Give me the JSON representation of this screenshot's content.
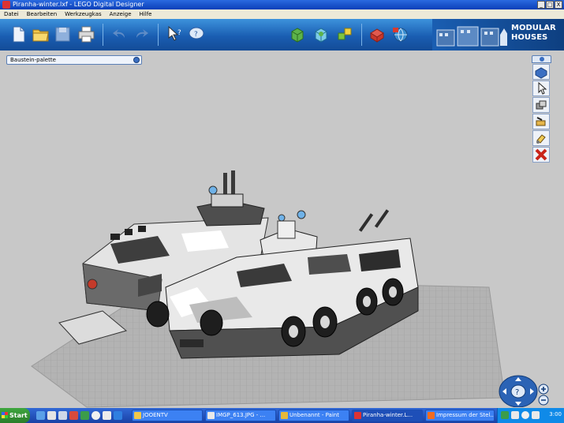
{
  "window": {
    "title": "Piranha-winter.lxf - LEGO Digital Designer",
    "controls": [
      "_",
      "□",
      "X"
    ]
  },
  "menu": [
    "Datei",
    "Bearbeiten",
    "Werkzeugkas",
    "Anzeige",
    "Hilfe"
  ],
  "toolbar": {
    "buttons": [
      {
        "name": "new-file-icon",
        "color": "#e8eef8"
      },
      {
        "name": "open-folder-icon",
        "color": "#f2c84b"
      },
      {
        "name": "save-icon",
        "color": "#9db6d8"
      },
      {
        "name": "print-icon",
        "color": "#d8d8d8"
      },
      {
        "name": "undo-icon",
        "color": "#6f9ad0"
      },
      {
        "name": "redo-icon",
        "color": "#6f9ad0"
      },
      {
        "name": "help-cursor-icon",
        "color": "#ffffff"
      },
      {
        "name": "help-bubble-icon",
        "color": "#ffffff"
      },
      {
        "name": "build-mode-icon",
        "color": "#5db34a"
      },
      {
        "name": "view-mode-icon",
        "color": "#3fa6d8"
      },
      {
        "name": "building-guide-icon",
        "color": "#7fc43f"
      },
      {
        "name": "share-brick-icon",
        "color": "#d83b2f"
      },
      {
        "name": "export-globe-icon",
        "color": "#d83b2f"
      }
    ],
    "brand_line1": "MODULAR",
    "brand_line2": "HOUSES"
  },
  "palette": {
    "label": "Baustein-palette"
  },
  "side_tools": [
    {
      "name": "select-brick-icon"
    },
    {
      "name": "cursor-tool-icon"
    },
    {
      "name": "clone-tool-icon"
    },
    {
      "name": "hinge-tool-icon"
    },
    {
      "name": "paint-tool-icon"
    },
    {
      "name": "delete-tool-icon"
    }
  ],
  "taskbar": {
    "start_label": "Start",
    "tasks": [
      {
        "label": "JOOENTV",
        "active": false
      },
      {
        "label": "IMGP_613.JPG - ...",
        "active": false
      },
      {
        "label": "Unbenannt - Paint",
        "active": false
      },
      {
        "label": "Piranha-winter.L...",
        "active": true
      },
      {
        "label": "Impressum der Stel...",
        "active": false
      }
    ],
    "clock": "3:00"
  },
  "colors": {
    "toolbar": "#1a5eb2",
    "floor": "#b3b3b3",
    "hull_light": "#eeeeee",
    "hull_dark": "#4a4a4a"
  }
}
